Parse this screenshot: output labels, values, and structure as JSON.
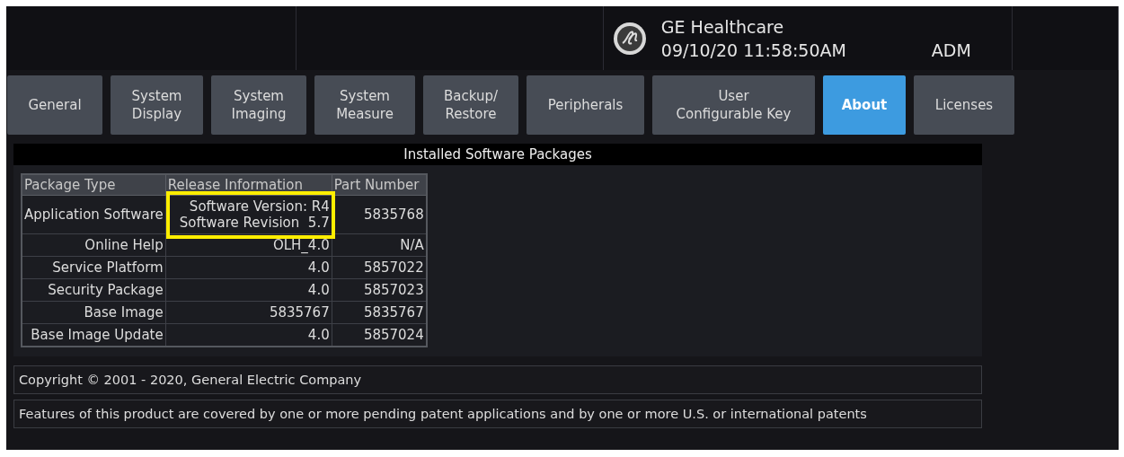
{
  "header": {
    "brand": "GE Healthcare",
    "datetime": "09/10/20 11:58:50AM",
    "user": "ADM"
  },
  "tabs": [
    {
      "label": "General",
      "selected": false
    },
    {
      "label": "System\nDisplay",
      "selected": false
    },
    {
      "label": "System\nImaging",
      "selected": false
    },
    {
      "label": "System\nMeasure",
      "selected": false
    },
    {
      "label": "Backup/\nRestore",
      "selected": false
    },
    {
      "label": "Peripherals",
      "selected": false
    },
    {
      "label": "User\nConfigurable Key",
      "selected": false
    },
    {
      "label": "About",
      "selected": true
    },
    {
      "label": "Licenses",
      "selected": false
    }
  ],
  "panel": {
    "title": "Installed Software Packages",
    "table": {
      "columns": [
        "Package Type",
        "Release Information",
        "Part Number"
      ],
      "rows": [
        {
          "package_type": "Application Software",
          "release": [
            "Software Version: R4",
            "Software Revision  5.7"
          ],
          "part_number": "5835768",
          "highlighted": true
        },
        {
          "package_type": "Online Help",
          "release": [
            "OLH_4.0"
          ],
          "part_number": "N/A",
          "highlighted": false
        },
        {
          "package_type": "Service Platform",
          "release": [
            "4.0"
          ],
          "part_number": "5857022",
          "highlighted": false
        },
        {
          "package_type": "Security Package",
          "release": [
            "4.0"
          ],
          "part_number": "5857023",
          "highlighted": false
        },
        {
          "package_type": "Base Image",
          "release": [
            "5835767"
          ],
          "part_number": "5835767",
          "highlighted": false
        },
        {
          "package_type": "Base Image Update",
          "release": [
            "4.0"
          ],
          "part_number": "5857024",
          "highlighted": false
        }
      ]
    }
  },
  "footer": [
    "Copyright © 2001 - 2020, General Electric Company",
    "Features of this product are covered by one or more pending patent applications and by one or more U.S. or international patents"
  ]
}
